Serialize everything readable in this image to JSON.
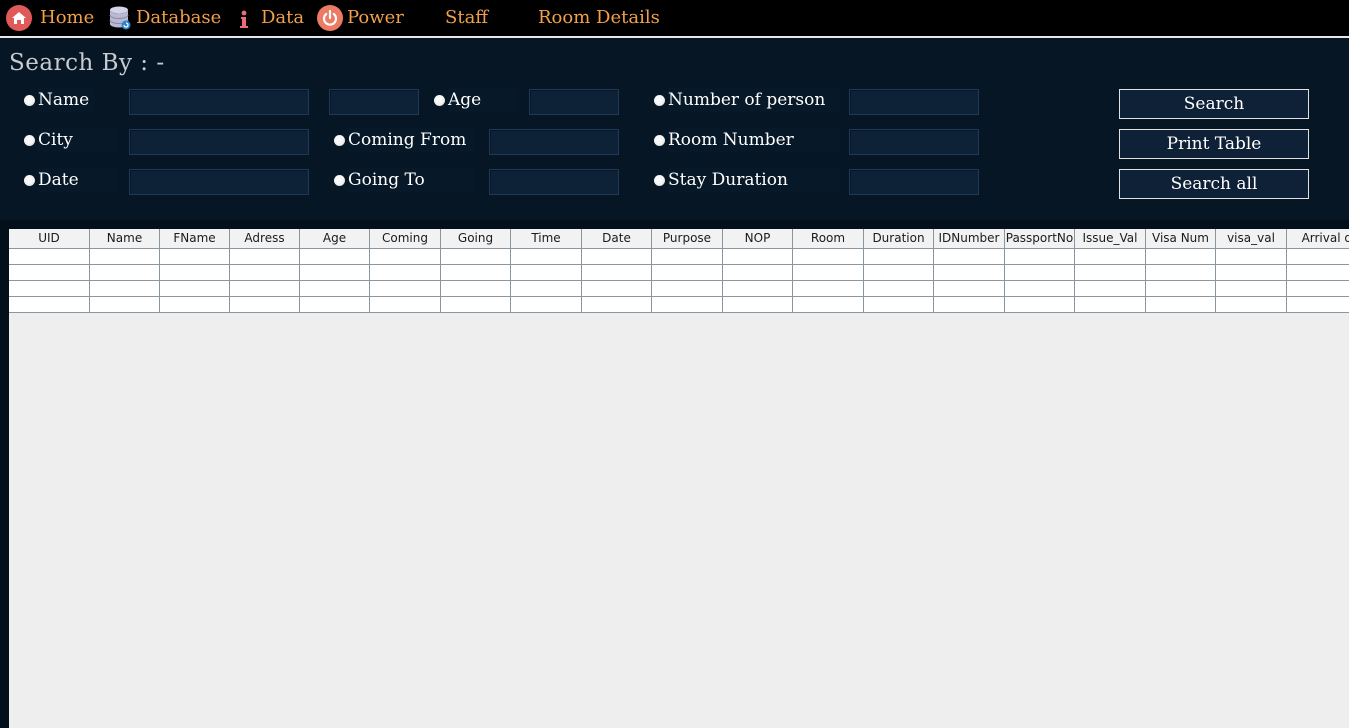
{
  "menu": [
    {
      "label": "Home",
      "icon": "home-icon"
    },
    {
      "label": "Database",
      "icon": "database-icon"
    },
    {
      "label": "Data",
      "icon": "info-icon"
    },
    {
      "label": "Power",
      "icon": "power-icon"
    },
    {
      "label": "Staff"
    },
    {
      "label": "Room Details"
    }
  ],
  "search": {
    "title": "Search By : -",
    "options": {
      "name": "Name",
      "age": "Age",
      "number_of_person": "Number of person",
      "city": "City",
      "coming_from": "Coming From",
      "room_number": "Room Number",
      "date": "Date",
      "going_to": "Going To",
      "stay_duration": "Stay Duration"
    },
    "fields": {
      "name_first": "",
      "name_second": "",
      "age": "",
      "number_of_person": "",
      "city": "",
      "coming_from": "",
      "room_number": "",
      "date": "",
      "going_to": "",
      "stay_duration": ""
    },
    "buttons": {
      "search": "Search",
      "print_table": "Print Table",
      "search_all": "Search all"
    }
  },
  "table": {
    "columns": [
      "UID",
      "Name",
      "FName",
      "Adress",
      "Age",
      "Coming",
      "Going",
      "Time",
      "Date",
      "Purpose",
      "NOP",
      "Room",
      "Duration",
      "IDNumber",
      "PassportNo",
      "Issue_Val",
      "Visa Num",
      "visa_val",
      "Arrival date"
    ],
    "rows": [
      [
        "",
        "",
        "",
        "",
        "",
        "",
        "",
        "",
        "",
        "",
        "",
        "",
        "",
        "",
        "",
        "",
        "",
        "",
        ""
      ],
      [
        "",
        "",
        "",
        "",
        "",
        "",
        "",
        "",
        "",
        "",
        "",
        "",
        "",
        "",
        "",
        "",
        "",
        "",
        ""
      ],
      [
        "",
        "",
        "",
        "",
        "",
        "",
        "",
        "",
        "",
        "",
        "",
        "",
        "",
        "",
        "",
        "",
        "",
        "",
        ""
      ],
      [
        "",
        "",
        "",
        "",
        "",
        "",
        "",
        "",
        "",
        "",
        "",
        "",
        "",
        "",
        "",
        "",
        "",
        "",
        ""
      ]
    ]
  },
  "colors": {
    "menu_text": "#f0a04a",
    "panel_bg": "#061625",
    "field_bg": "#0e2237",
    "icon_red": "#e05a5a"
  }
}
